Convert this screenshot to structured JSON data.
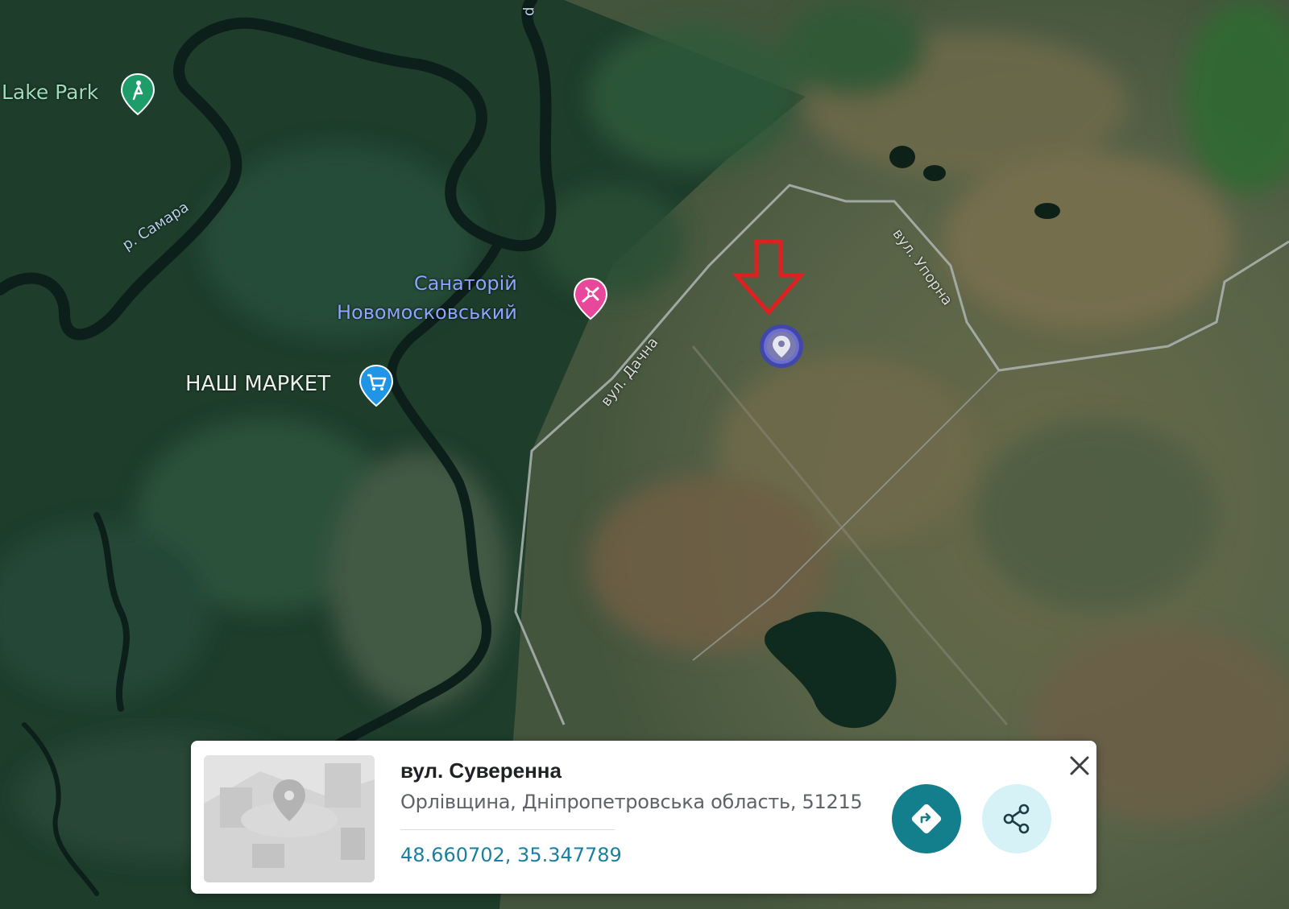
{
  "map": {
    "pois": [
      {
        "label": "Lake Park",
        "icon": "golf-icon",
        "color": "#1e9c6a"
      },
      {
        "label_lines": [
          "Санаторій",
          "Новомосковський"
        ],
        "icon": "hospital-icon",
        "color": "#e8479a"
      },
      {
        "label": "НАШ МАРКЕТ",
        "icon": "shopping-cart-icon",
        "color": "#1f95e8"
      }
    ],
    "roads": [
      "вул. Дачна",
      "вул. Упорна"
    ],
    "rivers": [
      "р. Самара"
    ],
    "top_river_fragment": "р",
    "selected_marker": {
      "icon": "location-pin-icon",
      "color": "#3f45b5"
    },
    "annotation_arrow_color": "#e02020"
  },
  "place_card": {
    "title": "вул. Суверенна",
    "address": "Орлівщина, Дніпропетровська область, 51215",
    "coordinates": "48.660702, 35.347789",
    "directions_button_color": "#137e8c",
    "share_button_color": "#d6f2f7",
    "icons": [
      "directions-icon",
      "share-icon",
      "close-icon"
    ]
  }
}
